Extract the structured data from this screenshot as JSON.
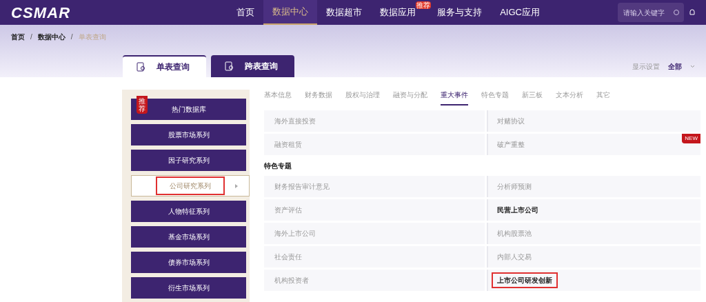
{
  "header": {
    "logo": "CSMAR",
    "nav": [
      {
        "label": "首页",
        "selected": false
      },
      {
        "label": "数据中心",
        "selected": true
      },
      {
        "label": "数据超市",
        "selected": false
      },
      {
        "label": "数据应用",
        "selected": false,
        "badge": "推荐"
      },
      {
        "label": "服务与支持",
        "selected": false
      },
      {
        "label": "AIGC应用",
        "selected": false
      }
    ],
    "search": {
      "placeholder": "请输入关键字"
    }
  },
  "breadcrumb": [
    {
      "label": "首页",
      "current": false
    },
    {
      "separator": "/"
    },
    {
      "label": "数据中心",
      "current": false
    },
    {
      "separator": "/"
    },
    {
      "label": "单表查询",
      "current": true
    }
  ],
  "query_tabs": [
    {
      "label": "单表查询",
      "selected": true
    },
    {
      "label": "跨表查询",
      "selected": false
    }
  ],
  "display_settings": {
    "label": "显示设置",
    "value": "全部"
  },
  "sidebar": {
    "items": [
      {
        "label": "热门数据库",
        "selected": false,
        "highlighted": false,
        "badge": "推荐"
      },
      {
        "label": "股票市场系列",
        "selected": false,
        "highlighted": false
      },
      {
        "label": "因子研究系列",
        "selected": false,
        "highlighted": false
      },
      {
        "label": "公司研究系列",
        "selected": true,
        "highlighted": true
      },
      {
        "label": "人物特征系列",
        "selected": false,
        "highlighted": false
      },
      {
        "label": "基金市场系列",
        "selected": false,
        "highlighted": false
      },
      {
        "label": "债券市场系列",
        "selected": false,
        "highlighted": false
      },
      {
        "label": "衍生市场系列",
        "selected": false,
        "highlighted": false
      }
    ]
  },
  "category_tabs": [
    {
      "label": "基本信息",
      "selected": false
    },
    {
      "label": "财务数据",
      "selected": false
    },
    {
      "label": "股权与治理",
      "selected": false
    },
    {
      "label": "融资与分配",
      "selected": false
    },
    {
      "label": "重大事件",
      "selected": true
    },
    {
      "label": "特色专题",
      "selected": false
    },
    {
      "label": "新三板",
      "selected": false
    },
    {
      "label": "文本分析",
      "selected": false
    },
    {
      "label": "其它",
      "selected": false
    }
  ],
  "sections": [
    {
      "rows": [
        {
          "cells": [
            {
              "label": "海外直接投资",
              "bold": false,
              "highlighted": false
            },
            {
              "label": "对赌协议",
              "bold": false,
              "highlighted": false
            }
          ]
        },
        {
          "cells": [
            {
              "label": "融资租赁",
              "bold": false,
              "highlighted": false
            },
            {
              "label": "破产重整",
              "bold": false,
              "highlighted": false,
              "badge": "NEW"
            }
          ]
        }
      ]
    },
    {
      "title": "特色专题",
      "rows": [
        {
          "cells": [
            {
              "label": "财务报告审计意见",
              "bold": false,
              "highlighted": false
            },
            {
              "label": "分析师预测",
              "bold": false,
              "highlighted": false
            }
          ]
        },
        {
          "cells": [
            {
              "label": "资产评估",
              "bold": false,
              "highlighted": false
            },
            {
              "label": "民营上市公司",
              "bold": true,
              "highlighted": false
            }
          ]
        },
        {
          "cells": [
            {
              "label": "海外上市公司",
              "bold": false,
              "highlighted": false
            },
            {
              "label": "机构股票池",
              "bold": false,
              "highlighted": false
            }
          ]
        },
        {
          "cells": [
            {
              "label": "社会责任",
              "bold": false,
              "highlighted": false
            },
            {
              "label": "内部人交易",
              "bold": false,
              "highlighted": false
            }
          ]
        },
        {
          "cells": [
            {
              "label": "机构投资者",
              "bold": false,
              "highlighted": false
            },
            {
              "label": "上市公司研发创新",
              "bold": true,
              "highlighted": true
            }
          ]
        }
      ]
    }
  ]
}
